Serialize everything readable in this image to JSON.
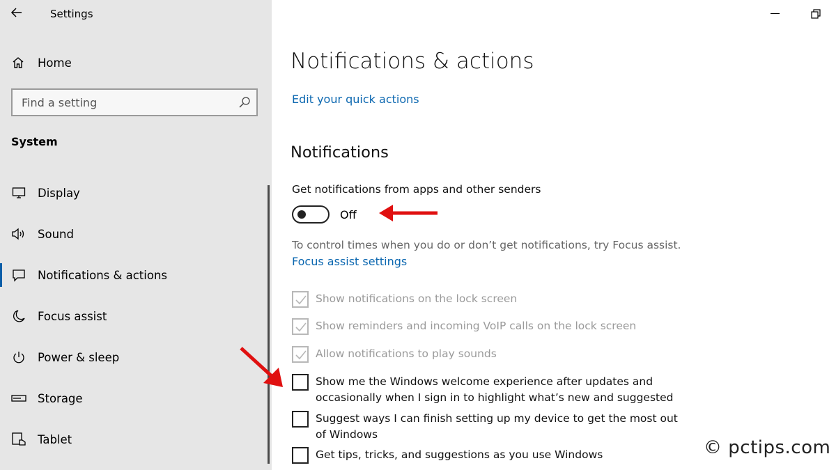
{
  "window": {
    "title": "Settings"
  },
  "sidebar": {
    "home_label": "Home",
    "search_placeholder": "Find a setting",
    "section_label": "System",
    "items": [
      {
        "label": "Display",
        "icon": "display-icon"
      },
      {
        "label": "Sound",
        "icon": "speaker-icon"
      },
      {
        "label": "Notifications & actions",
        "icon": "message-icon",
        "active": true
      },
      {
        "label": "Focus assist",
        "icon": "moon-icon"
      },
      {
        "label": "Power & sleep",
        "icon": "power-icon"
      },
      {
        "label": "Storage",
        "icon": "storage-icon"
      },
      {
        "label": "Tablet",
        "icon": "tablet-icon"
      }
    ]
  },
  "main": {
    "title": "Notifications & actions",
    "quick_actions_link": "Edit your quick actions",
    "section_heading": "Notifications",
    "toggle_caption": "Get notifications from apps and other senders",
    "toggle_state": "Off",
    "focus_text": "To control times when you do or don’t get notifications, try Focus assist.",
    "focus_link": "Focus assist settings",
    "checkboxes": [
      {
        "label": "Show notifications on the lock screen",
        "checked": true,
        "disabled": true
      },
      {
        "label": "Show reminders and incoming VoIP calls on the lock screen",
        "checked": true,
        "disabled": true
      },
      {
        "label": "Allow notifications to play sounds",
        "checked": true,
        "disabled": true
      },
      {
        "label_line1": "Show me the Windows welcome experience after updates and",
        "label_line2": "occasionally when I sign in to highlight what’s new and suggested",
        "checked": false,
        "disabled": false
      },
      {
        "label_line1": "Suggest ways I can finish setting up my device to get the most out",
        "label_line2": "of Windows",
        "checked": false,
        "disabled": false
      },
      {
        "label": "Get tips, tricks, and suggestions as you use Windows",
        "checked": false,
        "disabled": false
      }
    ]
  },
  "watermark": "© pctips.com",
  "colors": {
    "sidebar_bg": "#e6e6e6",
    "link": "#0b67b0",
    "accent": "#0a5ea8",
    "annotation_arrow": "#e01010"
  }
}
